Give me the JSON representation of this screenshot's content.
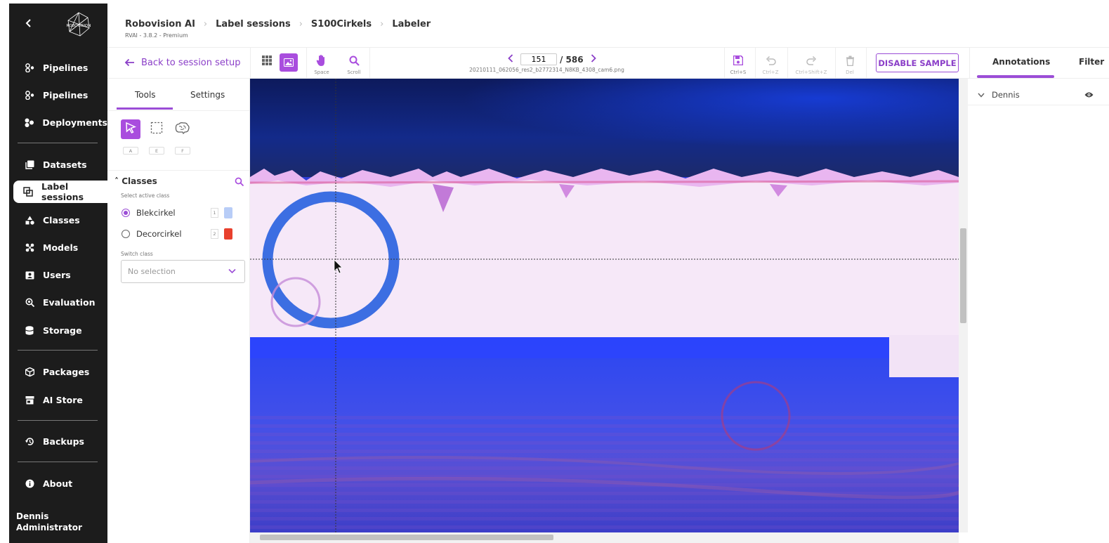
{
  "sidebar": {
    "back_icon": "chevron-left-icon",
    "logo_text": "ROBOVISION",
    "items": [
      {
        "label": "Pipelines",
        "icon": "pipelines-icon"
      },
      {
        "label": "Pipelines",
        "icon": "pipelines-icon"
      },
      {
        "label": "Deployments",
        "icon": "deployments-icon"
      },
      {
        "label": "Datasets",
        "icon": "datasets-icon"
      },
      {
        "label": "Label sessions",
        "icon": "label-sessions-icon",
        "active": true
      },
      {
        "label": "Classes",
        "icon": "classes-icon"
      },
      {
        "label": "Models",
        "icon": "models-icon"
      },
      {
        "label": "Users",
        "icon": "users-icon"
      },
      {
        "label": "Evaluation",
        "icon": "evaluation-icon"
      },
      {
        "label": "Storage",
        "icon": "storage-icon"
      },
      {
        "label": "Packages",
        "icon": "packages-icon"
      },
      {
        "label": "AI Store",
        "icon": "store-icon"
      },
      {
        "label": "Backups",
        "icon": "backups-icon"
      },
      {
        "label": "About",
        "icon": "info-icon"
      }
    ],
    "user": {
      "name": "Dennis",
      "role": "Administrator"
    }
  },
  "header": {
    "breadcrumbs": [
      "Robovision AI",
      "Label sessions",
      "S100Cirkels",
      "Labeler"
    ],
    "version": "RVAI - 3.8.2 - Premium"
  },
  "toolbar": {
    "back_label": "Back to session setup",
    "space_key": "Space",
    "scroll_key": "Scroll",
    "current_page": "151",
    "total_pages": "/ 586",
    "filename": "20210111_062056_res2_b2772314_N8KB_4308_cam6.png",
    "save_key": "Ctrl+S",
    "undo_key": "Ctrl+Z",
    "redo_key": "Ctrl+Shift+Z",
    "delete_key": "Del",
    "disable_label": "DISABLE SAMPLE"
  },
  "right_tabs": {
    "annotations": "Annotations",
    "filter": "Filter"
  },
  "tools_panel": {
    "tabs": {
      "tools": "Tools",
      "settings": "Settings"
    },
    "tool_keys": {
      "select": "A",
      "box": "E",
      "brain": "F"
    },
    "classes_heading": "Classes",
    "select_active_label": "Select active class",
    "classes": [
      {
        "name": "Blekcirkel",
        "key": "1",
        "color": "#b8cdf7",
        "selected": true
      },
      {
        "name": "Decorcirkel",
        "key": "2",
        "color": "#e8402d",
        "selected": false
      }
    ],
    "switch_class_label": "Switch class",
    "switch_placeholder": "No selection"
  },
  "annotations": {
    "user": "Dennis"
  },
  "colors": {
    "accent": "#9b4dd6",
    "sidebar_bg": "#1c1c1c"
  }
}
